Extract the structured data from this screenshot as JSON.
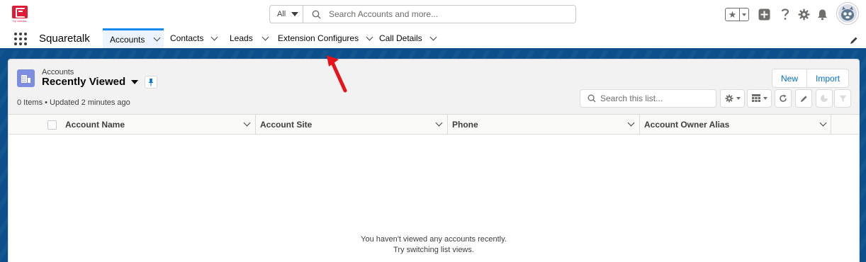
{
  "header": {
    "logo_subtext": "by ameba",
    "search": {
      "scope": "All",
      "placeholder": "Search Accounts and more..."
    }
  },
  "nav": {
    "app_name": "Squaretalk",
    "tabs": [
      {
        "label": "Accounts",
        "active": true
      },
      {
        "label": "Contacts"
      },
      {
        "label": "Leads"
      },
      {
        "label": "Extension Configures"
      },
      {
        "label": "Call Details"
      }
    ]
  },
  "list_view": {
    "object_label": "Accounts",
    "title": "Recently Viewed",
    "status": "0 Items • Updated 2 minutes ago",
    "buttons": {
      "new": "New",
      "import": "Import"
    },
    "search_placeholder": "Search this list...",
    "columns": [
      "Account Name",
      "Account Site",
      "Phone",
      "Account Owner Alias"
    ],
    "empty_line1": "You haven't viewed any accounts recently.",
    "empty_line2": "Try switching list views."
  },
  "colors": {
    "brand_red": "#e01b35",
    "link_blue": "#0070d2",
    "band_blue": "#0b4f8c",
    "annotation_red": "#e8131a"
  }
}
